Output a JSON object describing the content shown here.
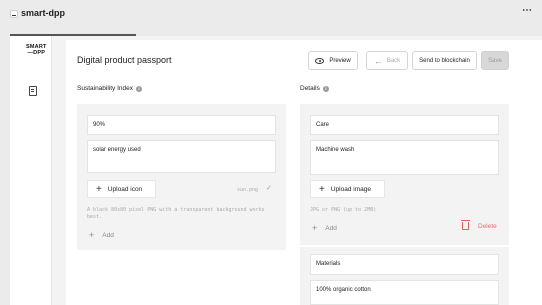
{
  "app": {
    "title": "smart-dpp",
    "menu_icon": "more-horizontal-icon"
  },
  "rail": {
    "logo_line1": "SMART",
    "logo_line2": "DPP",
    "nav_icon": "document-icon"
  },
  "page": {
    "title": "Digital product passport"
  },
  "toolbar": {
    "preview_label": "Preview",
    "back_label": "Back",
    "send_label": "Send to blockchain",
    "save_label": "Save"
  },
  "sustainability": {
    "label": "Sustainability Index",
    "value": "90%",
    "description": "solar energy used",
    "upload_label": "Upload icon",
    "file_name": "sun.png",
    "hint": "A black 80x80 pixel PNG with a transparent background works best.",
    "add_label": "Add"
  },
  "details": {
    "label": "Details",
    "item1_title": "Care",
    "item1_value": "Machine wash",
    "upload_label": "Upload image",
    "hint": "JPG or PNG (up to 2MB)",
    "add_label": "Add",
    "delete_label": "Delete",
    "item2_title": "Materials",
    "item2_value": "100% organic cotton"
  },
  "colors": {
    "delete": "#e07070",
    "accent": "#222222"
  }
}
